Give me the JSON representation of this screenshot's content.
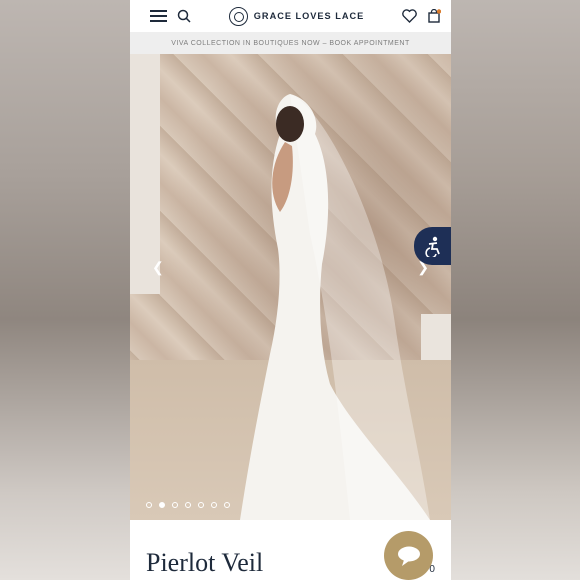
{
  "header": {
    "brand": "GRACE LOVES LACE",
    "menu_icon": "hamburger-menu-icon",
    "search_icon": "search-icon",
    "wishlist_icon": "heart-icon",
    "cart_icon": "shopping-bag-icon"
  },
  "promo": {
    "text": "VIVA COLLECTION IN BOUTIQUES NOW – BOOK APPOINTMENT"
  },
  "carousel": {
    "slides_count": 7,
    "active_index": 1,
    "prev_icon": "chevron-left-icon",
    "next_icon": "chevron-right-icon"
  },
  "product": {
    "title": "Pierlot Veil",
    "price": "US$ 0"
  },
  "accessibility": {
    "icon": "accessibility-icon"
  },
  "chat": {
    "icon": "chat-icon"
  },
  "colors": {
    "navy": "#1e2a3b",
    "accent_gold": "#b59b69",
    "accessibility_blue": "#1e2f56"
  }
}
